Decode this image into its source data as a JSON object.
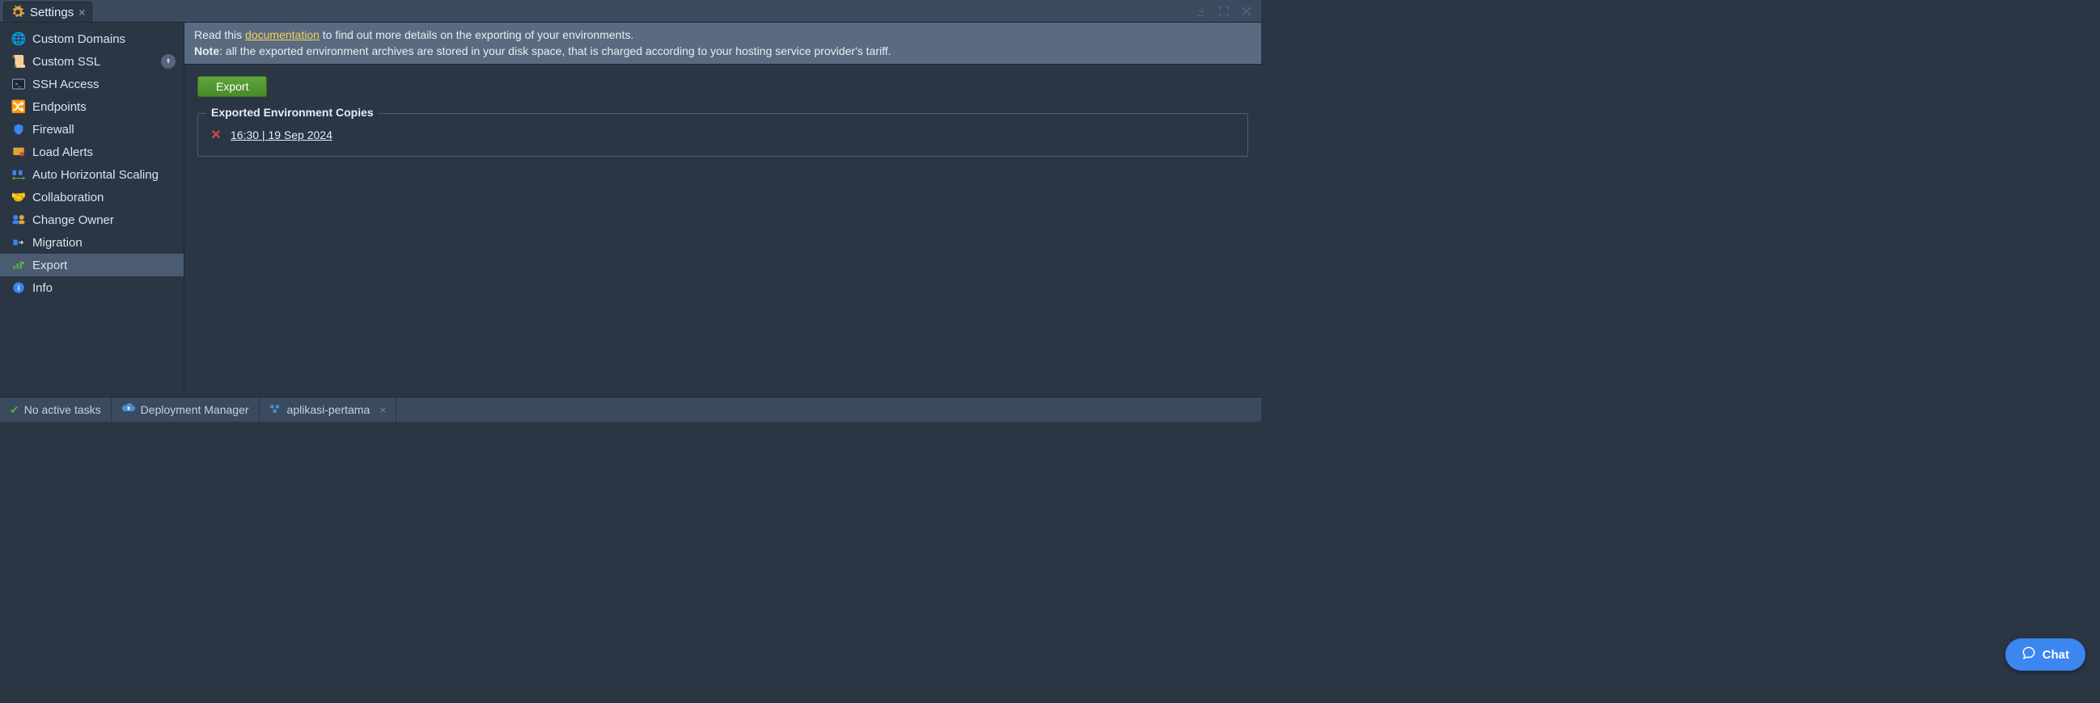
{
  "tab": {
    "title": "Settings"
  },
  "sidebar": {
    "items": [
      {
        "label": "Custom Domains"
      },
      {
        "label": "Custom SSL"
      },
      {
        "label": "SSH Access"
      },
      {
        "label": "Endpoints"
      },
      {
        "label": "Firewall"
      },
      {
        "label": "Load Alerts"
      },
      {
        "label": "Auto Horizontal Scaling"
      },
      {
        "label": "Collaboration"
      },
      {
        "label": "Change Owner"
      },
      {
        "label": "Migration"
      },
      {
        "label": "Export"
      },
      {
        "label": "Info"
      }
    ]
  },
  "banner": {
    "readPrefix": "Read this ",
    "docLink": "documentation",
    "readSuffix": " to find out more details on the exporting of your environments.",
    "noteLabel": "Note",
    "noteText": ": all the exported environment archives are stored in your disk space, that is charged according to your hosting service provider's tariff."
  },
  "actions": {
    "exportLabel": "Export"
  },
  "exportSection": {
    "legend": "Exported Environment Copies",
    "entries": [
      {
        "label": "16:30 | 19 Sep 2024"
      }
    ]
  },
  "footer": {
    "tasks": "No active tasks",
    "deployment": "Deployment Manager",
    "envTab": "aplikasi-pertama"
  },
  "chat": {
    "label": "Chat"
  }
}
